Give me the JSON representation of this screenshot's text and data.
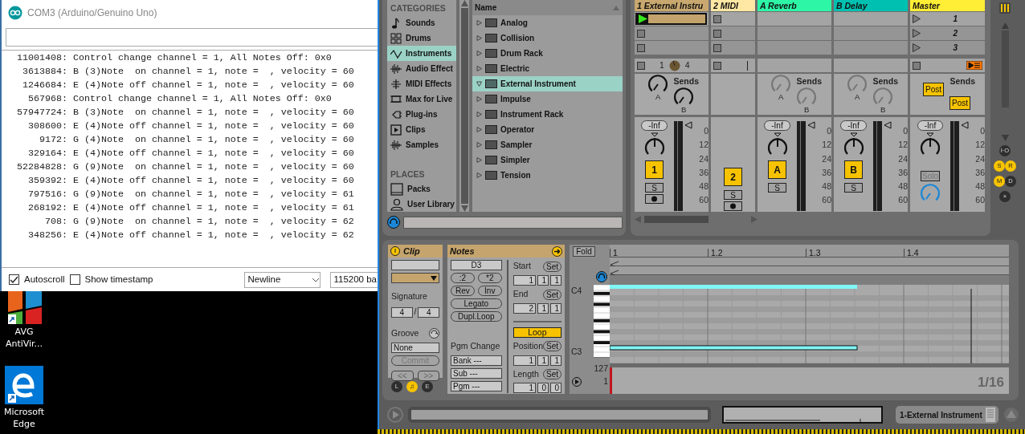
{
  "arduino": {
    "title": "COM3 (Arduino/Genuino Uno)",
    "log": [
      "11001408: Control change channel = 1, All Notes Off: 0x0",
      " 3613884: B (3)Note  on channel = 1, note =  , velocity = 60",
      " 1246684: E (4)Note off channel = 1, note =  , velocity = 60",
      "  567968: Control change channel = 1, All Notes Off: 0x0",
      "57947724: B (3)Note  on channel = 1, note =  , velocity = 60",
      "  308600: E (4)Note off channel = 1, note =  , velocity = 60",
      "    9172: G (4)Note  on channel = 1, note =  , velocity = 60",
      "  329164: E (4)Note off channel = 1, note =  , velocity = 60",
      "52284828: G (9)Note  on channel = 1, note =  , velocity = 60",
      "  359392: E (4)Note off channel = 1, note =  , velocity = 60",
      "  797516: G (9)Note  on channel = 1, note =  , velocity = 61",
      "  268192: E (4)Note off channel = 1, note =  , velocity = 61",
      "     708: G (9)Note  on channel = 1, note =  , velocity = 62",
      "  348256: E (4)Note off channel = 1, note =  , velocity = 62"
    ],
    "autoscroll": {
      "label": "Autoscroll",
      "checked": true
    },
    "timestamp": {
      "label": "Show timestamp",
      "checked": false
    },
    "line_ending": "Newline",
    "baud": "115200 ba"
  },
  "desktop_icons": [
    {
      "label": "AVG AntiVir...",
      "kind": "avg"
    },
    {
      "label": "Microsoft Edge",
      "kind": "edge"
    }
  ],
  "browser": {
    "categories_heading": "CATEGORIES",
    "categories": [
      {
        "label": "Sounds",
        "kind": "note",
        "selected": false
      },
      {
        "label": "Drums",
        "kind": "grid",
        "selected": false
      },
      {
        "label": "Instruments",
        "kind": "wave",
        "selected": true
      },
      {
        "label": "Audio Effect",
        "kind": "audio",
        "selected": false
      },
      {
        "label": "MIDI Effects",
        "kind": "midi",
        "selected": false
      },
      {
        "label": "Max for Live",
        "kind": "max",
        "selected": false
      },
      {
        "label": "Plug-ins",
        "kind": "plug",
        "selected": false
      },
      {
        "label": "Clips",
        "kind": "clip",
        "selected": false
      },
      {
        "label": "Samples",
        "kind": "audio",
        "selected": false
      }
    ],
    "places_heading": "PLACES",
    "places": [
      {
        "label": "Packs",
        "kind": "packs"
      },
      {
        "label": "User Library",
        "kind": "user"
      }
    ],
    "column": "Name",
    "items": [
      {
        "label": "Analog",
        "expanded": false,
        "selected": false
      },
      {
        "label": "Collision",
        "expanded": false,
        "selected": false
      },
      {
        "label": "Drum Rack",
        "expanded": false,
        "selected": false
      },
      {
        "label": "Electric",
        "expanded": false,
        "selected": false
      },
      {
        "label": "External Instrument",
        "expanded": true,
        "selected": true
      },
      {
        "label": "Impulse",
        "expanded": false,
        "selected": false
      },
      {
        "label": "Instrument Rack",
        "expanded": false,
        "selected": false
      },
      {
        "label": "Operator",
        "expanded": false,
        "selected": false
      },
      {
        "label": "Sampler",
        "expanded": false,
        "selected": false
      },
      {
        "label": "Simpler",
        "expanded": false,
        "selected": false
      },
      {
        "label": "Tension",
        "expanded": false,
        "selected": false
      }
    ]
  },
  "mixer": {
    "tracks": [
      {
        "name": "1 External Instru",
        "color": "#c8a86e",
        "kind": "track",
        "slots": [
          {
            "has_clip": true,
            "playing": true
          },
          {
            "has_clip": false
          },
          {
            "has_clip": false
          }
        ],
        "io": {
          "in": "1",
          "out": "4"
        },
        "sends": {
          "label": "Sends",
          "knobs": [
            "A",
            "B"
          ],
          "enabled": true
        },
        "volume": "-Inf",
        "meter_scale": [
          "0",
          "12",
          "24",
          "36",
          "48",
          "60"
        ],
        "activator": "1",
        "active": true,
        "solo": "S",
        "arm": true
      },
      {
        "name": "2 MIDI",
        "color": "#ffe8a4",
        "kind": "track",
        "slots": [
          {
            "has_clip": false
          },
          {
            "has_clip": false
          },
          {
            "has_clip": false
          }
        ],
        "activator": "2",
        "active": true,
        "solo": "S",
        "arm": true
      },
      {
        "name": "A Reverb",
        "color": "#2df6a6",
        "kind": "return",
        "sends": {
          "label": "Sends",
          "knobs": [
            "A",
            "B"
          ],
          "enabled": false
        },
        "volume": "-Inf",
        "meter_scale": [
          "0",
          "12",
          "24",
          "36",
          "48",
          "60"
        ],
        "activator": "A",
        "active": true,
        "solo": "S"
      },
      {
        "name": "B Delay",
        "color": "#00c1b1",
        "kind": "return",
        "sends": {
          "label": "Sends",
          "knobs": [
            "A",
            "B"
          ],
          "enabled": false
        },
        "volume": "-Inf",
        "meter_scale": [
          "0",
          "12",
          "24",
          "36",
          "48",
          "60"
        ],
        "activator": "B",
        "active": true,
        "solo": "S"
      },
      {
        "name": "Master",
        "color": "#ffee35",
        "kind": "master",
        "scenes": [
          "1",
          "2",
          "3"
        ],
        "sends": {
          "label": "Sends",
          "post": [
            "Post",
            "Post"
          ]
        },
        "volume": "-Inf",
        "meter_scale": [
          "0",
          "12",
          "24",
          "36",
          "48",
          "60"
        ],
        "solo": "Solo"
      }
    ],
    "side_buttons": [
      {
        "label": "I·O",
        "on": false
      },
      {
        "label": "S",
        "on": true
      },
      {
        "label": "R",
        "on": true
      },
      {
        "label": "M",
        "on": true
      },
      {
        "label": "D",
        "on": false
      },
      {
        "label": "×",
        "on": false
      }
    ]
  },
  "clip_view": {
    "clip": {
      "title": "Clip",
      "signature_label": "Signature",
      "signature": [
        "4",
        "/",
        "4"
      ],
      "groove_label": "Groove",
      "groove": "None",
      "commit": "Commit",
      "nav": [
        "<<",
        ">>"
      ]
    },
    "views": [
      {
        "label": "L",
        "selected": false
      },
      {
        "label": "♫",
        "selected": true
      },
      {
        "label": "E",
        "selected": false
      }
    ],
    "notes": {
      "title": "Notes",
      "key": "D3",
      "buttons": [
        [
          ":2",
          "*2"
        ],
        [
          "Rev",
          "Inv"
        ],
        [
          "Legato"
        ],
        [
          "Dupl.Loop"
        ]
      ],
      "pgm_label": "Pgm Change",
      "pgm_fields": [
        "Bank ---",
        "Sub ---",
        "Pgm ---"
      ],
      "markers": [
        {
          "label": "Start",
          "button": "Set",
          "values": [
            "1",
            "1",
            "1"
          ]
        },
        {
          "label": "End",
          "button": "Set",
          "values": [
            "2",
            "1",
            "1"
          ]
        }
      ],
      "loop": {
        "label": "Loop",
        "on": true
      },
      "loop_markers": [
        {
          "label": "Position",
          "button": "Set",
          "values": [
            "1",
            "1",
            "1"
          ]
        },
        {
          "label": "Length",
          "button": "Set",
          "values": [
            "1",
            "0",
            "0"
          ]
        }
      ]
    },
    "piano_roll": {
      "fold": "Fold",
      "ruler": [
        "1",
        "1.2",
        "1.3",
        "1.4"
      ],
      "key_labels": [
        "C4",
        "C3"
      ],
      "velocity_range": [
        "127",
        "1"
      ],
      "grid": "1/16"
    }
  },
  "status_bar": {
    "device": "1-External Instrument"
  }
}
